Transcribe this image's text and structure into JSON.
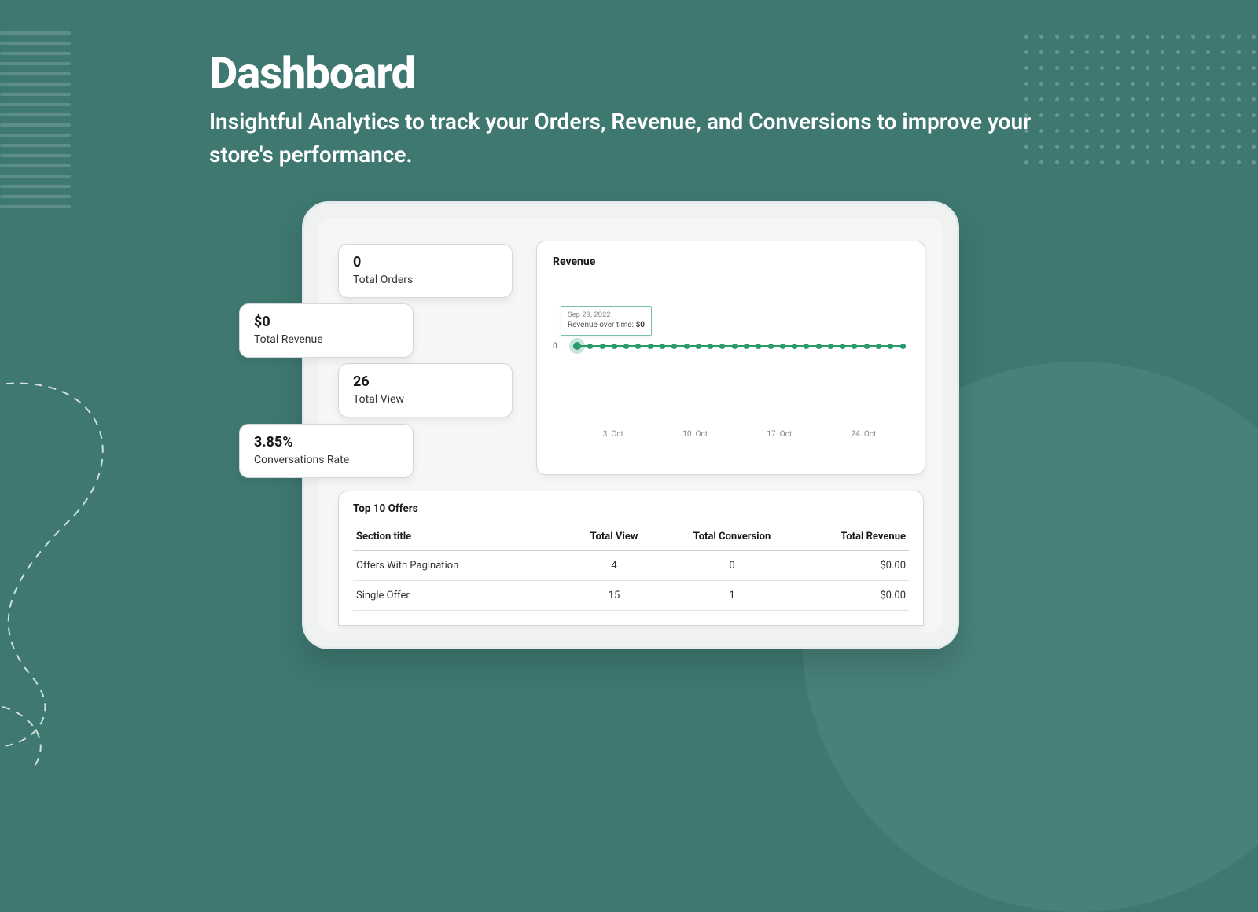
{
  "page": {
    "title": "Dashboard",
    "subtitle": "Insightful Analytics to track your Orders, Revenue, and Conversions to improve your store's performance."
  },
  "stats": {
    "orders": {
      "value": "0",
      "label": "Total Orders"
    },
    "revenue": {
      "value": "$0",
      "label": "Total Revenue"
    },
    "views": {
      "value": "26",
      "label": "Total View"
    },
    "convrate": {
      "value": "3.85%",
      "label": "Conversations Rate"
    }
  },
  "chart": {
    "title": "Revenue",
    "y_zero_label": "0",
    "tooltip": {
      "date": "Sep 29, 2022",
      "label": "Revenue over time:",
      "value": "$0"
    },
    "x_ticks": [
      "3. Oct",
      "10. Oct",
      "17. Oct",
      "24. Oct"
    ]
  },
  "chart_data": {
    "type": "line",
    "title": "Revenue",
    "xlabel": "",
    "ylabel": "",
    "ylim": [
      0,
      1
    ],
    "x": [
      "Sep 29",
      "Sep 30",
      "Oct 1",
      "Oct 2",
      "Oct 3",
      "Oct 4",
      "Oct 5",
      "Oct 6",
      "Oct 7",
      "Oct 8",
      "Oct 9",
      "Oct 10",
      "Oct 11",
      "Oct 12",
      "Oct 13",
      "Oct 14",
      "Oct 15",
      "Oct 16",
      "Oct 17",
      "Oct 18",
      "Oct 19",
      "Oct 20",
      "Oct 21",
      "Oct 22",
      "Oct 23",
      "Oct 24",
      "Oct 25",
      "Oct 26"
    ],
    "series": [
      {
        "name": "Revenue over time",
        "values": [
          0,
          0,
          0,
          0,
          0,
          0,
          0,
          0,
          0,
          0,
          0,
          0,
          0,
          0,
          0,
          0,
          0,
          0,
          0,
          0,
          0,
          0,
          0,
          0,
          0,
          0,
          0,
          0
        ]
      }
    ],
    "x_tick_labels": [
      "3. Oct",
      "10. Oct",
      "17. Oct",
      "24. Oct"
    ]
  },
  "offers": {
    "title": "Top 10 Offers",
    "columns": [
      "Section title",
      "Total View",
      "Total Conversion",
      "Total Revenue"
    ],
    "rows": [
      {
        "title": "Offers With Pagination",
        "view": "4",
        "conv": "0",
        "rev": "$0.00"
      },
      {
        "title": "Single Offer",
        "view": "15",
        "conv": "1",
        "rev": "$0.00"
      }
    ]
  }
}
